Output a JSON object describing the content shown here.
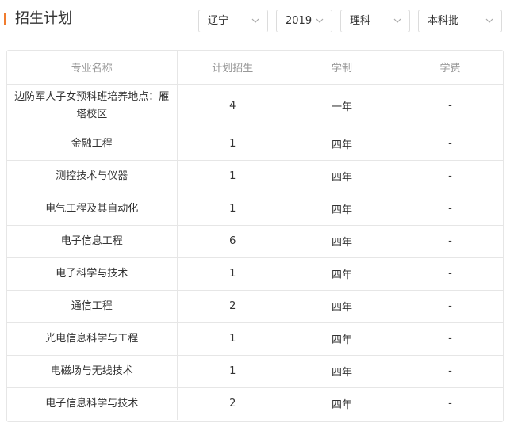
{
  "header": {
    "title": "招生计划"
  },
  "filters": {
    "province": "辽宁",
    "year": "2019",
    "subject": "理科",
    "batch": "本科批"
  },
  "table": {
    "columns": [
      "专业名称",
      "计划招生",
      "学制",
      "学费"
    ],
    "rows": [
      {
        "name": "边防军人子女预科班培养地点：雁塔校区",
        "plan": "4",
        "duration": "一年",
        "fee": "-"
      },
      {
        "name": "金融工程",
        "plan": "1",
        "duration": "四年",
        "fee": "-"
      },
      {
        "name": "测控技术与仪器",
        "plan": "1",
        "duration": "四年",
        "fee": "-"
      },
      {
        "name": "电气工程及其自动化",
        "plan": "1",
        "duration": "四年",
        "fee": "-"
      },
      {
        "name": "电子信息工程",
        "plan": "6",
        "duration": "四年",
        "fee": "-"
      },
      {
        "name": "电子科学与技术",
        "plan": "1",
        "duration": "四年",
        "fee": "-"
      },
      {
        "name": "通信工程",
        "plan": "2",
        "duration": "四年",
        "fee": "-"
      },
      {
        "name": "光电信息科学与工程",
        "plan": "1",
        "duration": "四年",
        "fee": "-"
      },
      {
        "name": "电磁场与无线技术",
        "plan": "1",
        "duration": "四年",
        "fee": "-"
      },
      {
        "name": "电子信息科学与技术",
        "plan": "2",
        "duration": "四年",
        "fee": "-"
      }
    ]
  },
  "colors": {
    "accent": "#f07c2f",
    "border": "#e6e6e6",
    "header_text": "#999999"
  }
}
